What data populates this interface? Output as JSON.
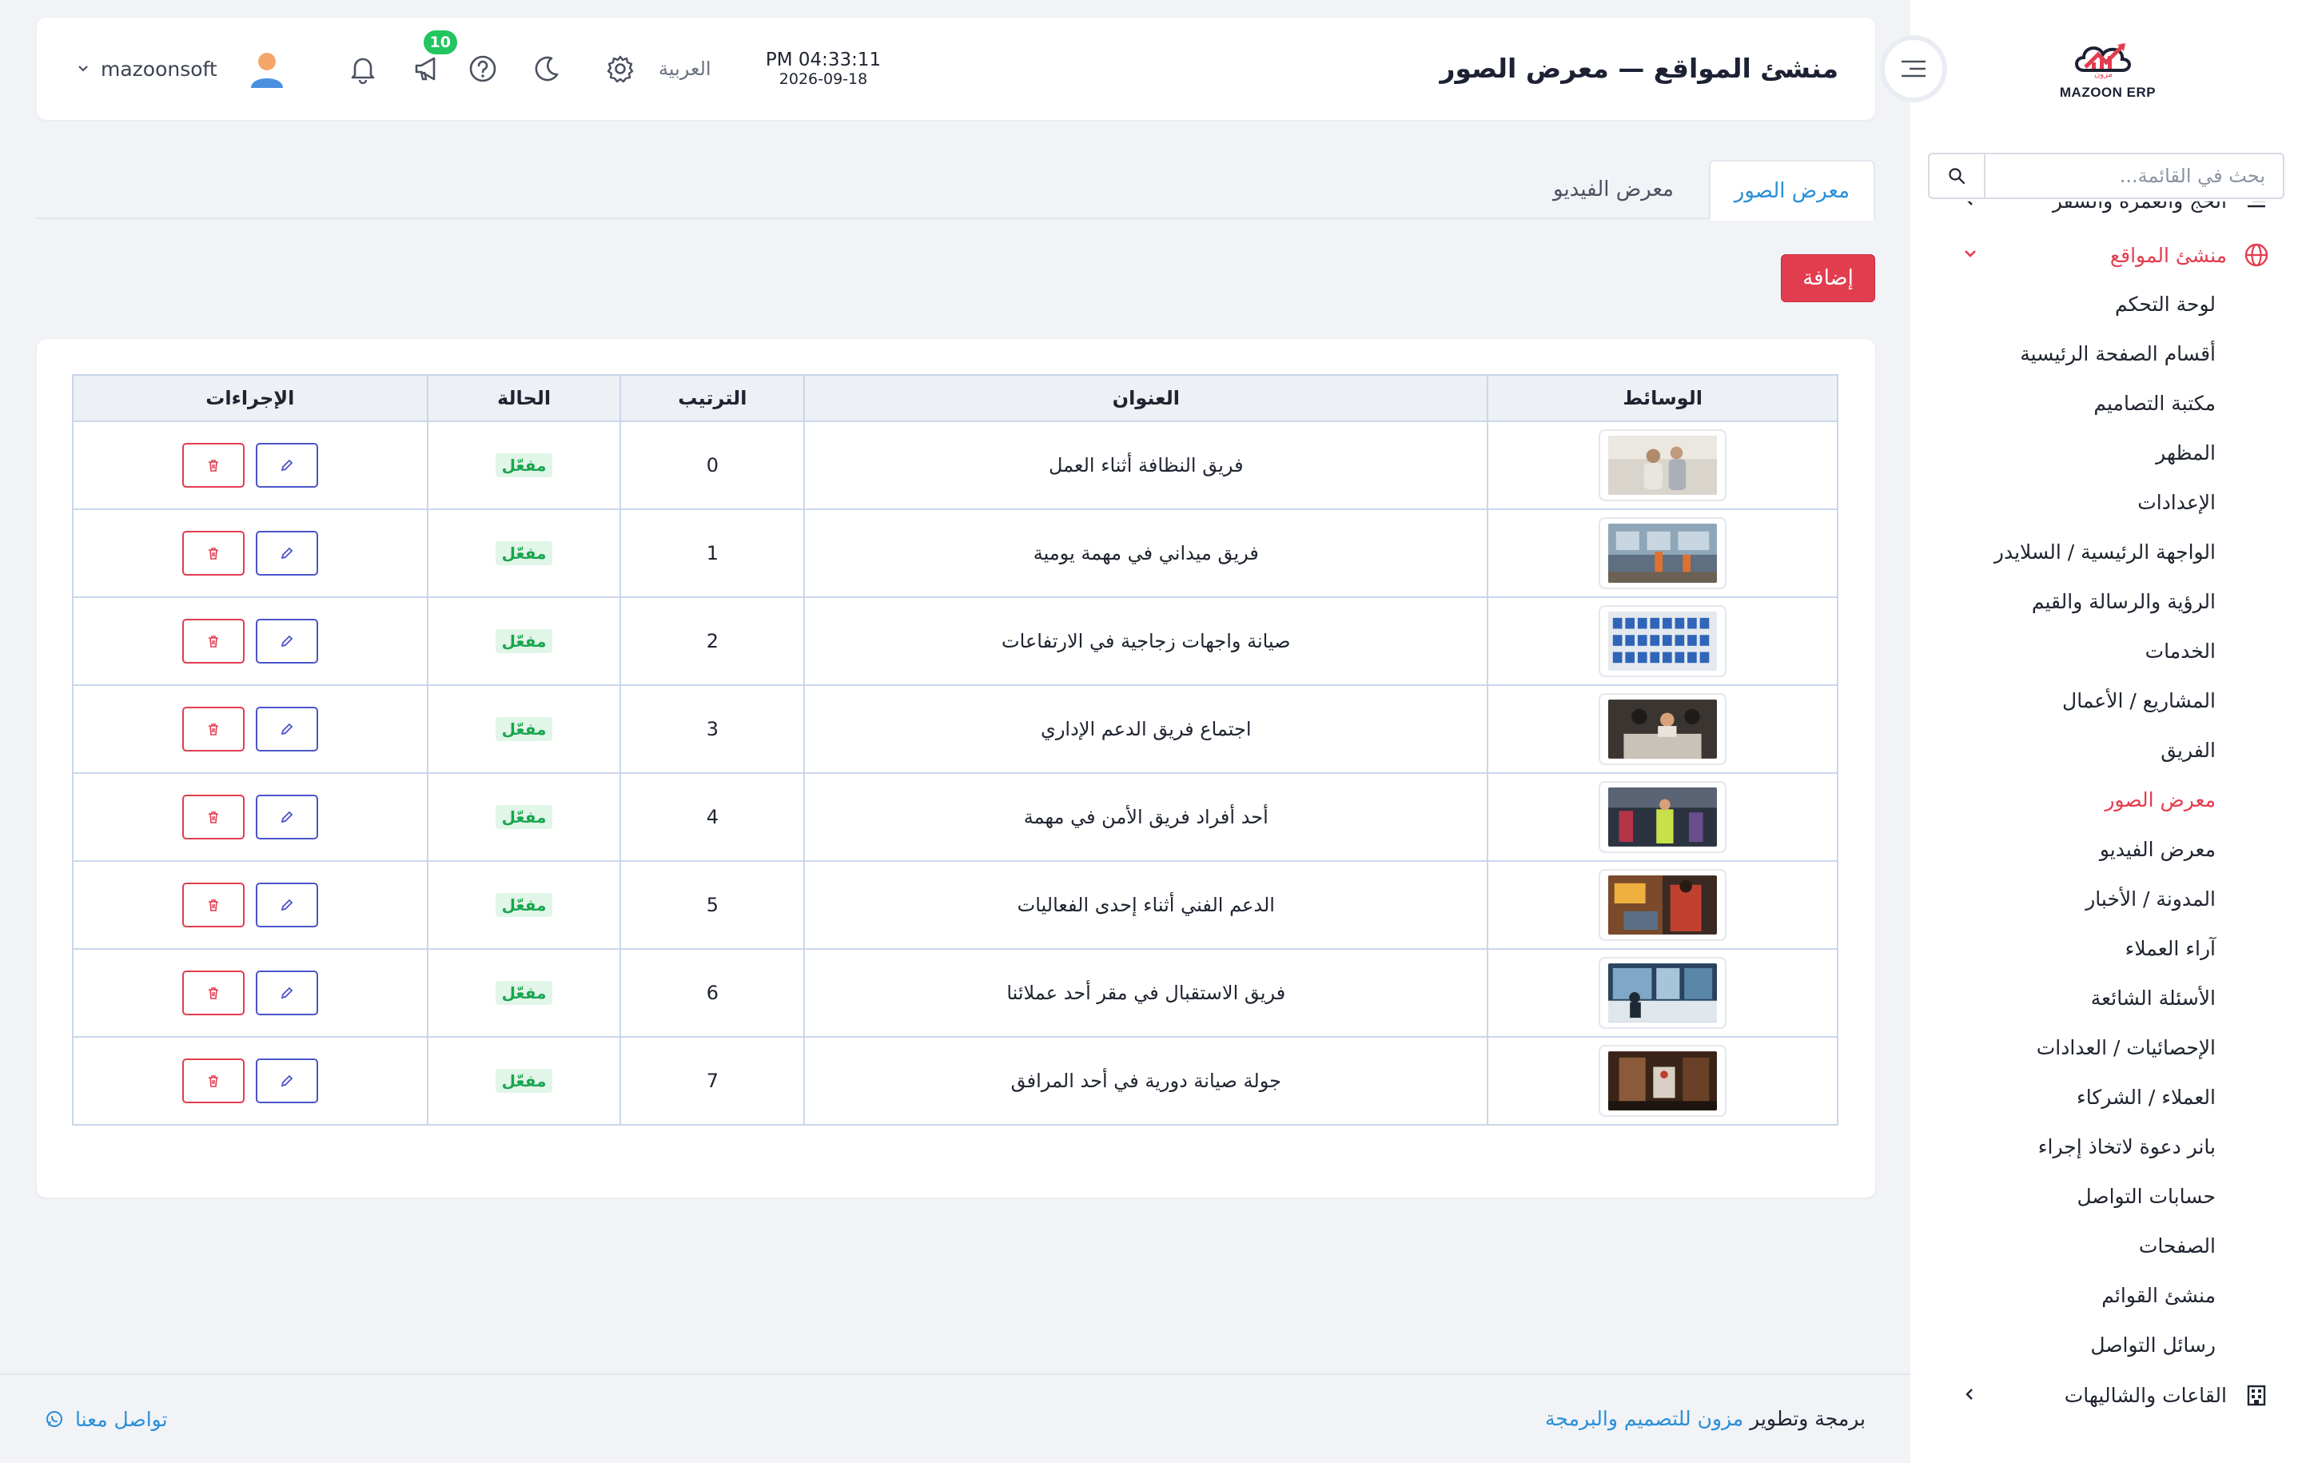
{
  "brand": {
    "logo_text": "MAZOON ERP",
    "logo_arabic": "مزون"
  },
  "sidebar": {
    "search_placeholder": "بحث في القائمة...",
    "partial_group_label": "الحج والعمرة والسفر",
    "group": {
      "label": "منشئ المواقع"
    },
    "items": [
      "لوحة التحكم",
      "أقسام الصفحة الرئيسية",
      "مكتبة التصاميم",
      "المظهر",
      "الإعدادات",
      "الواجهة الرئيسية / السلايدر",
      "الرؤية والرسالة والقيم",
      "الخدمات",
      "المشاريع / الأعمال",
      "الفريق",
      "معرض الصور",
      "معرض الفيديو",
      "المدونة / الأخبار",
      "آراء العملاء",
      "الأسئلة الشائعة",
      "الإحصائيات / العدادات",
      "العملاء / الشركاء",
      "بانر دعوة لاتخاذ إجراء",
      "حسابات التواصل",
      "الصفحات",
      "منشئ القوائم",
      "رسائل التواصل"
    ],
    "bottom_group": "القاعات والشاليهات"
  },
  "header": {
    "title": "منشئ المواقع — معرض الصور",
    "time": "PM 04:33:11",
    "date": "2026-09-18",
    "language": "العربية",
    "notifications_count": "10",
    "username": "mazoonsoft"
  },
  "tabs": {
    "photos": "معرض الصور",
    "videos": "معرض الفيديو"
  },
  "add_button": "إضافة",
  "table": {
    "headers": {
      "media": "الوسائط",
      "title": "العنوان",
      "order": "الترتيب",
      "status": "الحالة",
      "actions": "الإجراءات"
    },
    "rows": [
      {
        "title": "فريق النظافة أثناء العمل",
        "order": "0",
        "status": "مفعّل"
      },
      {
        "title": "فريق ميداني في مهمة يومية",
        "order": "1",
        "status": "مفعّل"
      },
      {
        "title": "صيانة واجهات زجاجية في الارتفاعات",
        "order": "2",
        "status": "مفعّل"
      },
      {
        "title": "اجتماع فريق الدعم الإداري",
        "order": "3",
        "status": "مفعّل"
      },
      {
        "title": "أحد أفراد فريق الأمن في مهمة",
        "order": "4",
        "status": "مفعّل"
      },
      {
        "title": "الدعم الفني أثناء إحدى الفعاليات",
        "order": "5",
        "status": "مفعّل"
      },
      {
        "title": "فريق الاستقبال في مقر أحد عملائنا",
        "order": "6",
        "status": "مفعّل"
      },
      {
        "title": "جولة صيانة دورية في أحد المرافق",
        "order": "7",
        "status": "مفعّل"
      }
    ]
  },
  "footer": {
    "credit_prefix": "برمجة وتطوير",
    "credit_brand": "مزون للتصميم والبرمجة",
    "contact": "تواصل معنا"
  },
  "colors": {
    "accent_red": "#e23d4f",
    "link_blue": "#2a8fd6",
    "success_green": "#22c55e",
    "edit_blue": "#4b55c8"
  }
}
